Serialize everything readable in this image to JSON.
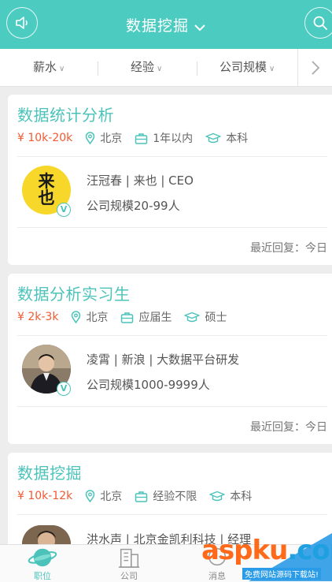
{
  "header": {
    "title": "数据挖掘",
    "left_icon": "speaker-icon",
    "right_icon": "search-icon",
    "accent": "#4ccbc0"
  },
  "filters": {
    "items": [
      {
        "label": "薪水"
      },
      {
        "label": "经验"
      },
      {
        "label": "公司规模"
      }
    ],
    "more_icon": "chevron-right-icon"
  },
  "jobs": [
    {
      "title": "数据统计分析",
      "salary": "¥ 10k-20k",
      "city": "北京",
      "experience": "1年以内",
      "education": "本科",
      "recruiter": "汪冠春 | 来也 | CEO",
      "company_size": "公司规模20-99人",
      "reply": "最近回复：今日",
      "logo_text": "来也"
    },
    {
      "title": "数据分析实习生",
      "salary": "¥ 2k-3k",
      "city": "北京",
      "experience": "应届生",
      "education": "硕士",
      "recruiter": "凌霄 | 新浪 | 大数据平台研发",
      "company_size": "公司规模1000-9999人",
      "reply": "最近回复：今日"
    },
    {
      "title": "数据挖掘",
      "salary": "¥ 10k-12k",
      "city": "北京",
      "experience": "经验不限",
      "education": "本科",
      "recruiter": "洪水声 | 北京金凯利科技 | 经理"
    }
  ],
  "verified_badge": "V",
  "tabbar": {
    "tabs": [
      {
        "icon": "planet-icon",
        "label": "职位"
      },
      {
        "icon": "building-icon",
        "label": "公司"
      },
      {
        "icon": "chat-icon",
        "label": "消息"
      }
    ]
  },
  "watermark": {
    "text": "aspku",
    "suffix": ".com",
    "sub": "免费网站源码下载站!"
  },
  "colors": {
    "title": "#4cc3ba",
    "salary": "#f05a30"
  }
}
